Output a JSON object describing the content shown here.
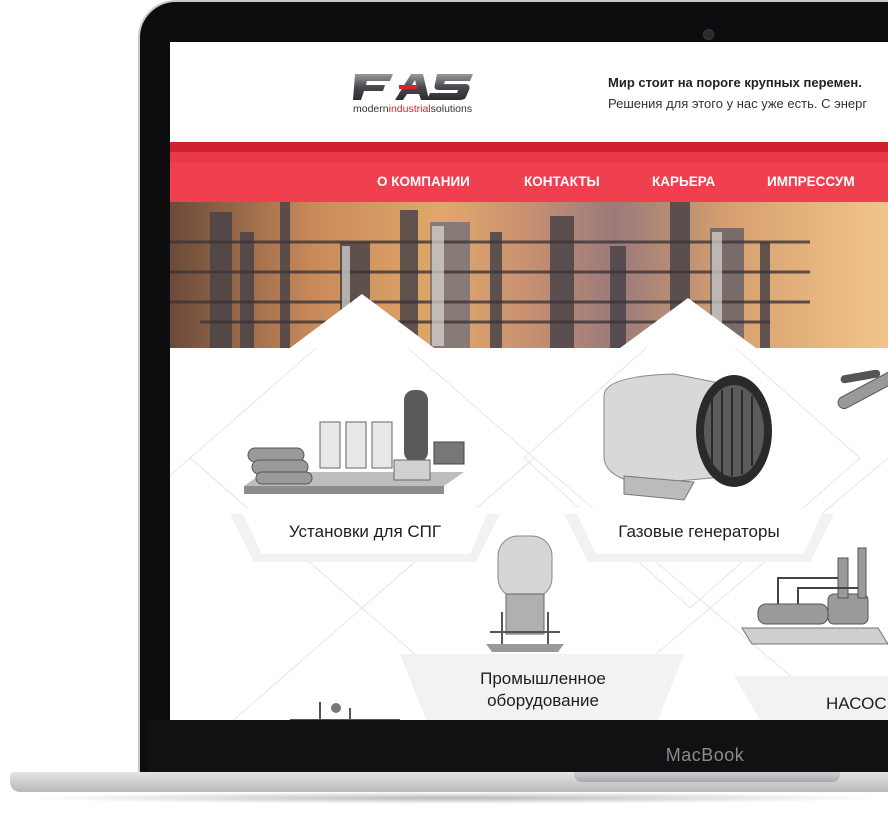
{
  "device": {
    "label": "MacBook"
  },
  "site": {
    "logo": {
      "letters": "FAS",
      "tag_part1": "modern",
      "tag_part2": "industrial",
      "tag_part3": "solutions"
    },
    "intro": {
      "title": "Мир стоит на пороге крупных перемен.",
      "text": "Решения для этого у нас уже есть. С энерг"
    },
    "nav": {
      "items": [
        {
          "label": "О КОМПАНИИ"
        },
        {
          "label": "КОНТАКТЫ"
        },
        {
          "label": "КАРЬЕРА"
        },
        {
          "label": "ИМПРЕССУМ"
        }
      ]
    },
    "products": [
      {
        "label": "Установки для СПГ"
      },
      {
        "label": "Газовые генераторы"
      },
      {
        "label": "Промышленное\nоборудование"
      },
      {
        "label": "НАСОС"
      }
    ]
  },
  "colors": {
    "nav": "#f04050",
    "stripe_dark": "#d01f2d",
    "brand_red": "#d8232a"
  }
}
